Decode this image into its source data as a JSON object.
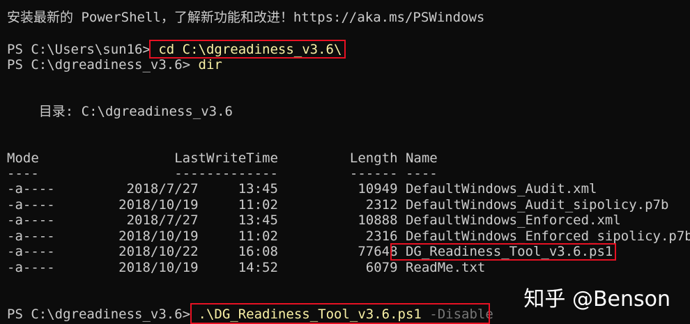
{
  "banner": "安装最新的 PowerShell，了解新功能和改进！https://aka.ms/PSWindows",
  "prompt1": {
    "prompt": "PS C:\\Users\\sun16> ",
    "command": "cd C:\\dgreadiness_v3.6\\"
  },
  "prompt2": {
    "prompt": "PS C:\\dgreadiness_v3.6> ",
    "command": "dir"
  },
  "directory_header": "    目录: C:\\dgreadiness_v3.6",
  "table": {
    "header": "Mode                 LastWriteTime         Length Name",
    "underline": "----                 -------------         ------ ----",
    "rows": [
      "-a----         2018/7/27     13:45          10949 DefaultWindows_Audit.xml",
      "-a----        2018/10/19     11:02           2312 DefaultWindows_Audit_sipolicy.p7b",
      "-a----         2018/7/27     13:45          10888 DefaultWindows_Enforced.xml",
      "-a----        2018/10/19     11:02           2316 DefaultWindows_Enforced_sipolicy.p7b",
      "-a----        2018/10/22     16:08          77648 DG_Readiness_Tool_v3.6.ps1",
      "-a----        2018/10/19     14:52           6079 ReadMe.txt"
    ]
  },
  "prompt3": {
    "prompt": "PS C:\\dgreadiness_v3.6> ",
    "command": ".\\DG_Readiness_Tool_v3.6.ps1",
    "argument": " -Disable"
  },
  "watermark": "知乎 @Benson",
  "colors": {
    "background": "#0c0c0c",
    "text": "#cccccc",
    "command": "#f9f1a5",
    "highlight_box": "#e81123"
  }
}
